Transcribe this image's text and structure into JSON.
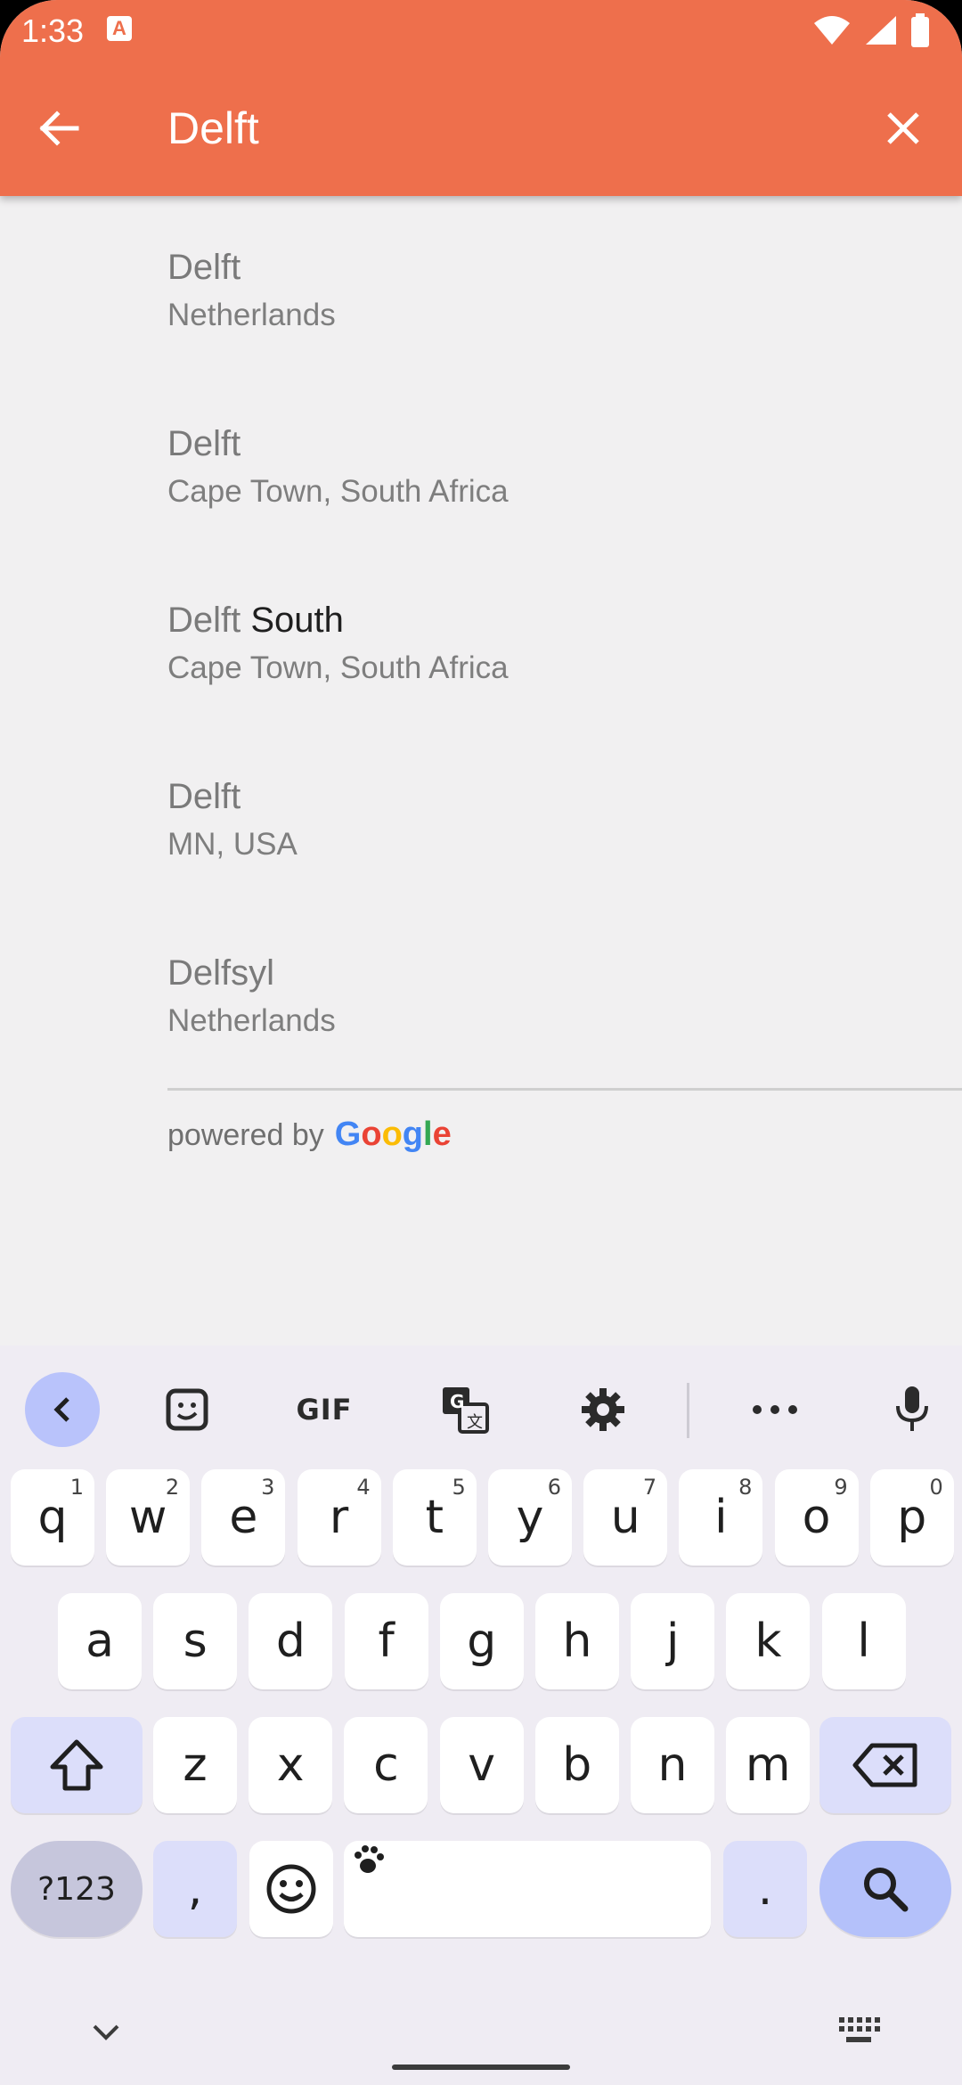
{
  "status_bar": {
    "time": "1:33",
    "notification_badge": "A",
    "icons": [
      "wifi-icon",
      "signal-icon",
      "battery-icon"
    ]
  },
  "search": {
    "query": "Delft"
  },
  "results": [
    {
      "title_main": "Delft",
      "title_extra": "",
      "subtitle": "Netherlands"
    },
    {
      "title_main": "Delft",
      "title_extra": "",
      "subtitle": "Cape Town, South Africa"
    },
    {
      "title_main": "Delft",
      "title_extra": " South",
      "subtitle": "Cape Town, South Africa"
    },
    {
      "title_main": "Delft",
      "title_extra": "",
      "subtitle": "MN, USA"
    },
    {
      "title_main": "Delfsyl",
      "title_extra": "",
      "subtitle": "Netherlands"
    }
  ],
  "attribution": {
    "prefix": "powered by",
    "logo_letters": [
      "G",
      "o",
      "o",
      "g",
      "l",
      "e"
    ],
    "logo_colors": [
      "#4285F4",
      "#EA4335",
      "#FBBC05",
      "#4285F4",
      "#34A853",
      "#EA4335"
    ]
  },
  "keyboard": {
    "toolbar": {
      "gif_label": "GIF"
    },
    "row1": [
      {
        "k": "q",
        "n": "1"
      },
      {
        "k": "w",
        "n": "2"
      },
      {
        "k": "e",
        "n": "3"
      },
      {
        "k": "r",
        "n": "4"
      },
      {
        "k": "t",
        "n": "5"
      },
      {
        "k": "y",
        "n": "6"
      },
      {
        "k": "u",
        "n": "7"
      },
      {
        "k": "i",
        "n": "8"
      },
      {
        "k": "o",
        "n": "9"
      },
      {
        "k": "p",
        "n": "0"
      }
    ],
    "row2": [
      "a",
      "s",
      "d",
      "f",
      "g",
      "h",
      "j",
      "k",
      "l"
    ],
    "row3": [
      "z",
      "x",
      "c",
      "v",
      "b",
      "n",
      "m"
    ],
    "symbols_label": "?123",
    "comma": ",",
    "period": "."
  },
  "colors": {
    "app_bar": "#ee6f4c",
    "background": "#f1f0f1",
    "keyboard_accent": "#b4c1fa"
  }
}
